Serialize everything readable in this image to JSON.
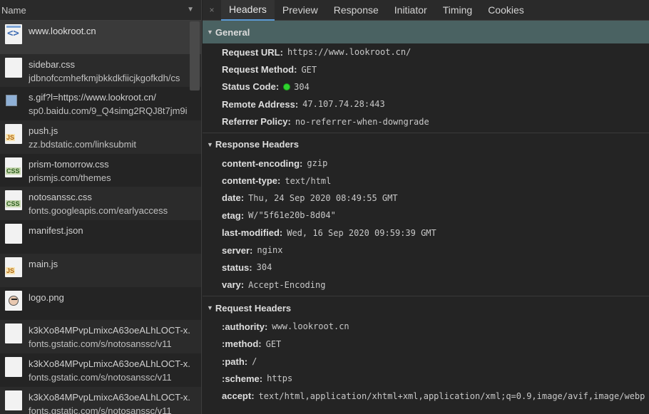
{
  "left": {
    "header": "Name",
    "requests": [
      {
        "name": "www.lookroot.cn",
        "sub": "",
        "icon": "document-icon",
        "type": "doc"
      },
      {
        "name": "sidebar.css",
        "sub": "jdbnofccmhefkmjbkkdkfiicjkgofkdh/cs",
        "icon": "blank-file-icon",
        "type": "blank"
      },
      {
        "name": "s.gif?l=https://www.lookroot.cn/",
        "sub": "sp0.baidu.com/9_Q4simg2RQJ8t7jm9i",
        "icon": "broken-image-icon",
        "type": "broken"
      },
      {
        "name": "push.js",
        "sub": "zz.bdstatic.com/linksubmit",
        "icon": "js-file-icon",
        "type": "js"
      },
      {
        "name": "prism-tomorrow.css",
        "sub": "prismjs.com/themes",
        "icon": "css-file-icon",
        "type": "css"
      },
      {
        "name": "notosanssc.css",
        "sub": "fonts.googleapis.com/earlyaccess",
        "icon": "css-file-icon",
        "type": "css"
      },
      {
        "name": "manifest.json",
        "sub": "",
        "icon": "blank-file-icon",
        "type": "blank"
      },
      {
        "name": "main.js",
        "sub": "",
        "icon": "js-file-icon",
        "type": "js"
      },
      {
        "name": "logo.png",
        "sub": "",
        "icon": "image-file-icon",
        "type": "img"
      },
      {
        "name": "k3kXo84MPvpLmixcA63oeALhLOCT-x.",
        "sub": "fonts.gstatic.com/s/notosanssc/v11",
        "icon": "blank-file-icon",
        "type": "blank"
      },
      {
        "name": "k3kXo84MPvpLmixcA63oeALhLOCT-x.",
        "sub": "fonts.gstatic.com/s/notosanssc/v11",
        "icon": "blank-file-icon",
        "type": "blank"
      },
      {
        "name": "k3kXo84MPvpLmixcA63oeALhLOCT-x.",
        "sub": "fonts.gstatic.com/s/notosanssc/v11",
        "icon": "blank-file-icon",
        "type": "blank"
      }
    ]
  },
  "tabs": {
    "close": "×",
    "items": [
      "Headers",
      "Preview",
      "Response",
      "Initiator",
      "Timing",
      "Cookies"
    ],
    "active": "Headers"
  },
  "general": {
    "title": "General",
    "rows": [
      {
        "k": "Request URL:",
        "v": "https://www.lookroot.cn/"
      },
      {
        "k": "Request Method:",
        "v": "GET"
      },
      {
        "k": "Status Code:",
        "v": "304",
        "dot": true
      },
      {
        "k": "Remote Address:",
        "v": "47.107.74.28:443"
      },
      {
        "k": "Referrer Policy:",
        "v": "no-referrer-when-downgrade"
      }
    ]
  },
  "response_headers": {
    "title": "Response Headers",
    "rows": [
      {
        "k": "content-encoding:",
        "v": "gzip"
      },
      {
        "k": "content-type:",
        "v": "text/html"
      },
      {
        "k": "date:",
        "v": "Thu, 24 Sep 2020 08:49:55 GMT"
      },
      {
        "k": "etag:",
        "v": "W/\"5f61e20b-8d04\""
      },
      {
        "k": "last-modified:",
        "v": "Wed, 16 Sep 2020 09:59:39 GMT"
      },
      {
        "k": "server:",
        "v": "nginx"
      },
      {
        "k": "status:",
        "v": "304"
      },
      {
        "k": "vary:",
        "v": "Accept-Encoding"
      }
    ]
  },
  "request_headers": {
    "title": "Request Headers",
    "rows": [
      {
        "k": ":authority:",
        "v": "www.lookroot.cn"
      },
      {
        "k": ":method:",
        "v": "GET"
      },
      {
        "k": ":path:",
        "v": "/"
      },
      {
        "k": ":scheme:",
        "v": "https"
      },
      {
        "k": "accept:",
        "v": "text/html,application/xhtml+xml,application/xml;q=0.9,image/avif,image/webp"
      }
    ]
  },
  "colors": {
    "background": "#242424",
    "general_header": "#4a6262",
    "active_tab_underline": "#5b9ad6",
    "status_green": "#2fd32f"
  }
}
